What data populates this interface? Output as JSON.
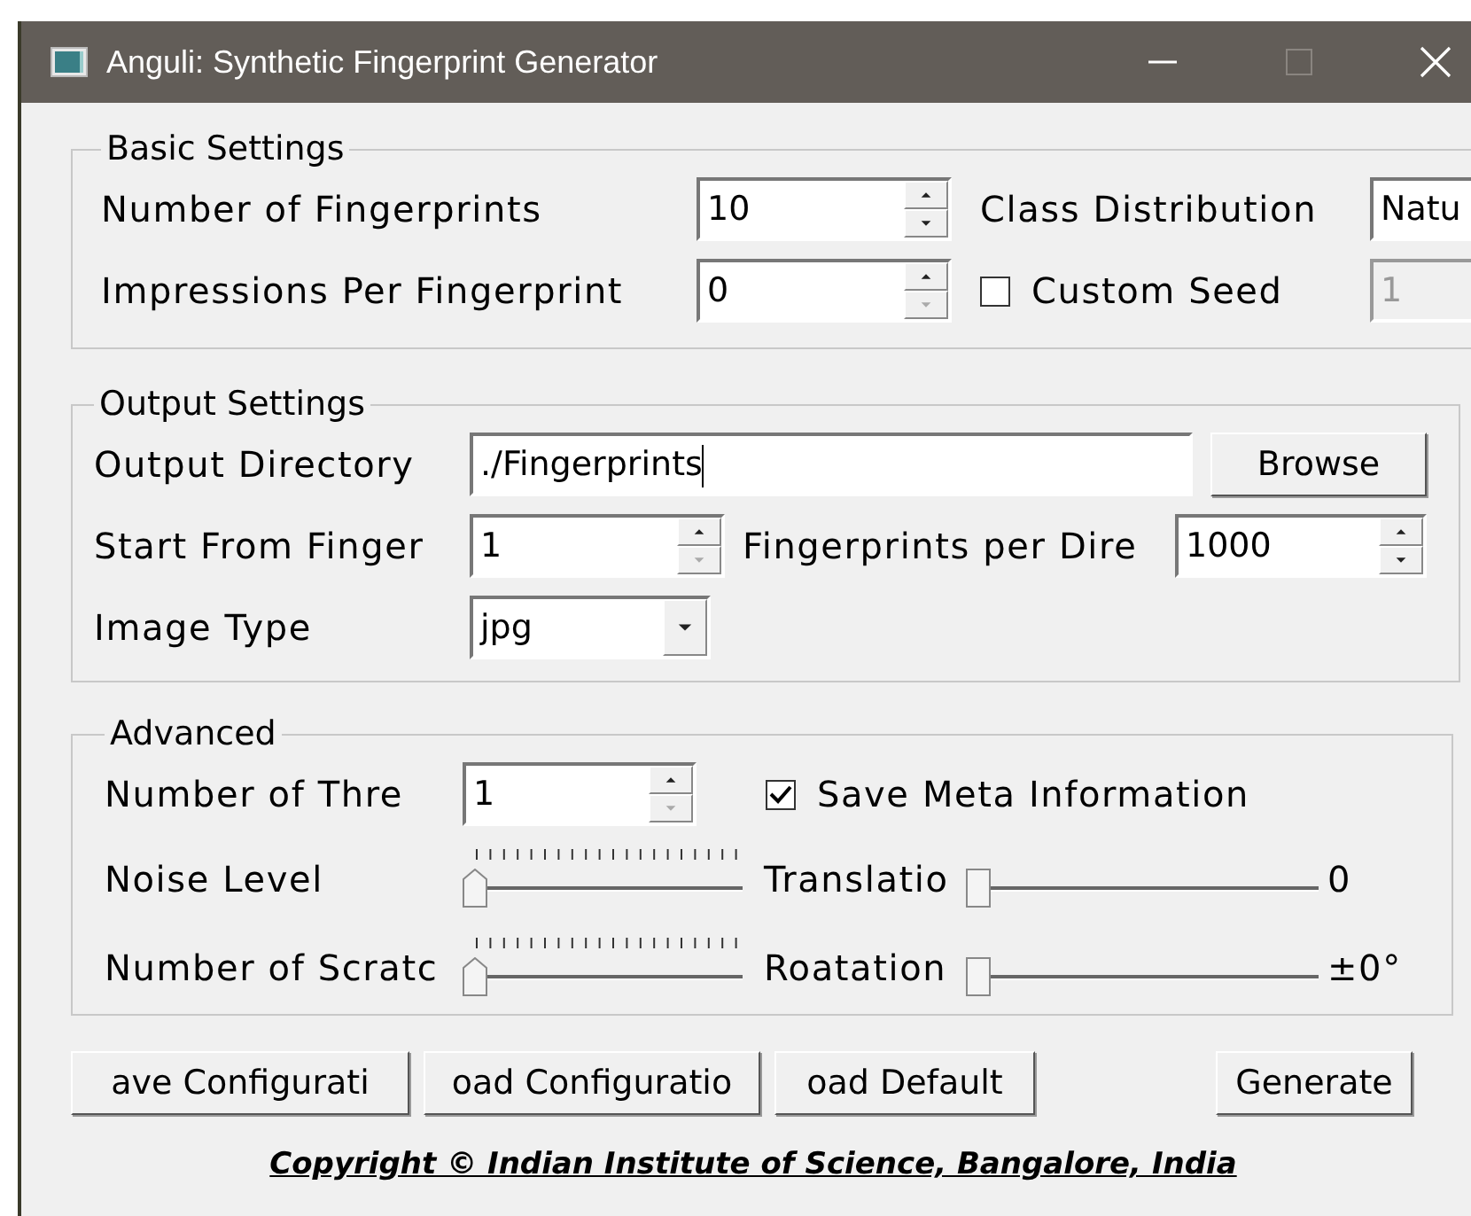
{
  "window": {
    "title": "Anguli: Synthetic Fingerprint Generator"
  },
  "basic_settings": {
    "title": "Basic Settings",
    "number_of_fingerprints": {
      "label": "Number of Fingerprints",
      "value": "10"
    },
    "class_distribution": {
      "label": "Class Distribution",
      "value": "Natu"
    },
    "impressions_per_fingerprint": {
      "label": "Impressions Per Fingerprint",
      "value": "0"
    },
    "custom_seed": {
      "label": "Custom Seed",
      "checked": false,
      "value": "1",
      "disabled": true
    }
  },
  "output_settings": {
    "title": "Output Settings",
    "output_directory": {
      "label": "Output Directory",
      "value": "./Fingerprints"
    },
    "browse_button": "Browse",
    "start_from": {
      "label": "Start From Finger",
      "value": "1"
    },
    "per_directory": {
      "label": "Fingerprints per Dire",
      "value": "1000"
    },
    "image_type": {
      "label": "Image Type",
      "value": "jpg"
    }
  },
  "advanced": {
    "title": "Advanced",
    "threads": {
      "label": "Number of Thre",
      "value": "1"
    },
    "save_meta": {
      "label": "Save Meta Information",
      "checked": true
    },
    "sliders": [
      {
        "label": "Noise Level",
        "level": 0,
        "ticks": true
      },
      {
        "label": "Translatio",
        "level": 0,
        "ticks": false,
        "reading": "0"
      },
      {
        "label": "Number of Scratc",
        "level": 0,
        "ticks": true
      },
      {
        "label": "Roatation",
        "level": 0,
        "ticks": false,
        "reading": "±0°"
      }
    ]
  },
  "buttons": [
    "ave Configurati",
    "oad Configuratio",
    "oad Default"
  ],
  "generate_button": "Generate",
  "footer": "Copyright © Indian Institute of Science, Bangalore, India"
}
